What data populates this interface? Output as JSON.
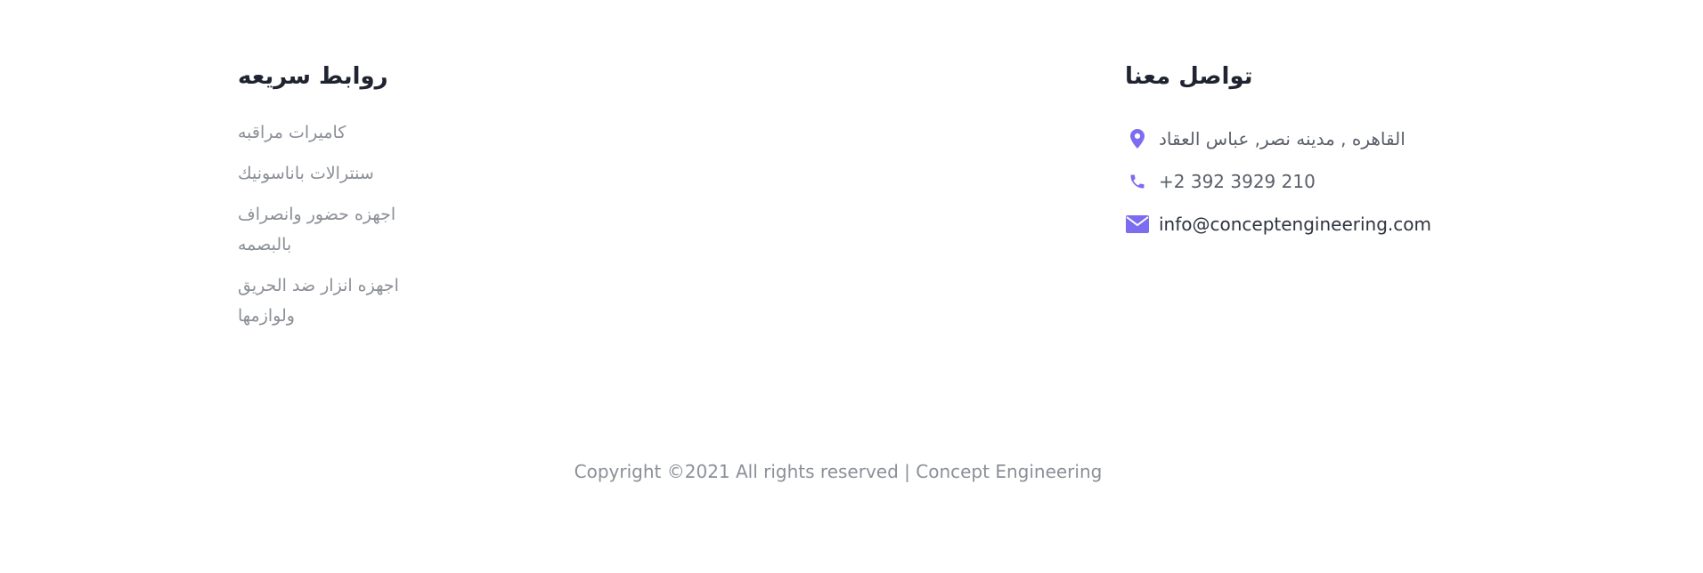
{
  "contact": {
    "title": "تواصل معنا",
    "address": "القاهره , مدينه نصر, عباس العقاد",
    "phone": "+2 392 3929 210",
    "email": "info@conceptengineering.com",
    "icon_color": "#7b6cf0",
    "icons": [
      "location-pin-icon",
      "phone-icon",
      "envelope-icon"
    ]
  },
  "quick_links": {
    "title": "روابط سريعه",
    "items": [
      {
        "label": "كاميرات مراقبه"
      },
      {
        "label": "سنترالات باناسونيك"
      },
      {
        "label": "اجهزه حضور وانصراف بالبصمه"
      },
      {
        "label": "اجهزه انزار ضد الحريق ولوازمها"
      }
    ]
  },
  "footer": {
    "copyright_prefix": "Copyright ©2021 All rights reserved |",
    "brand": "Concept Engineering"
  }
}
